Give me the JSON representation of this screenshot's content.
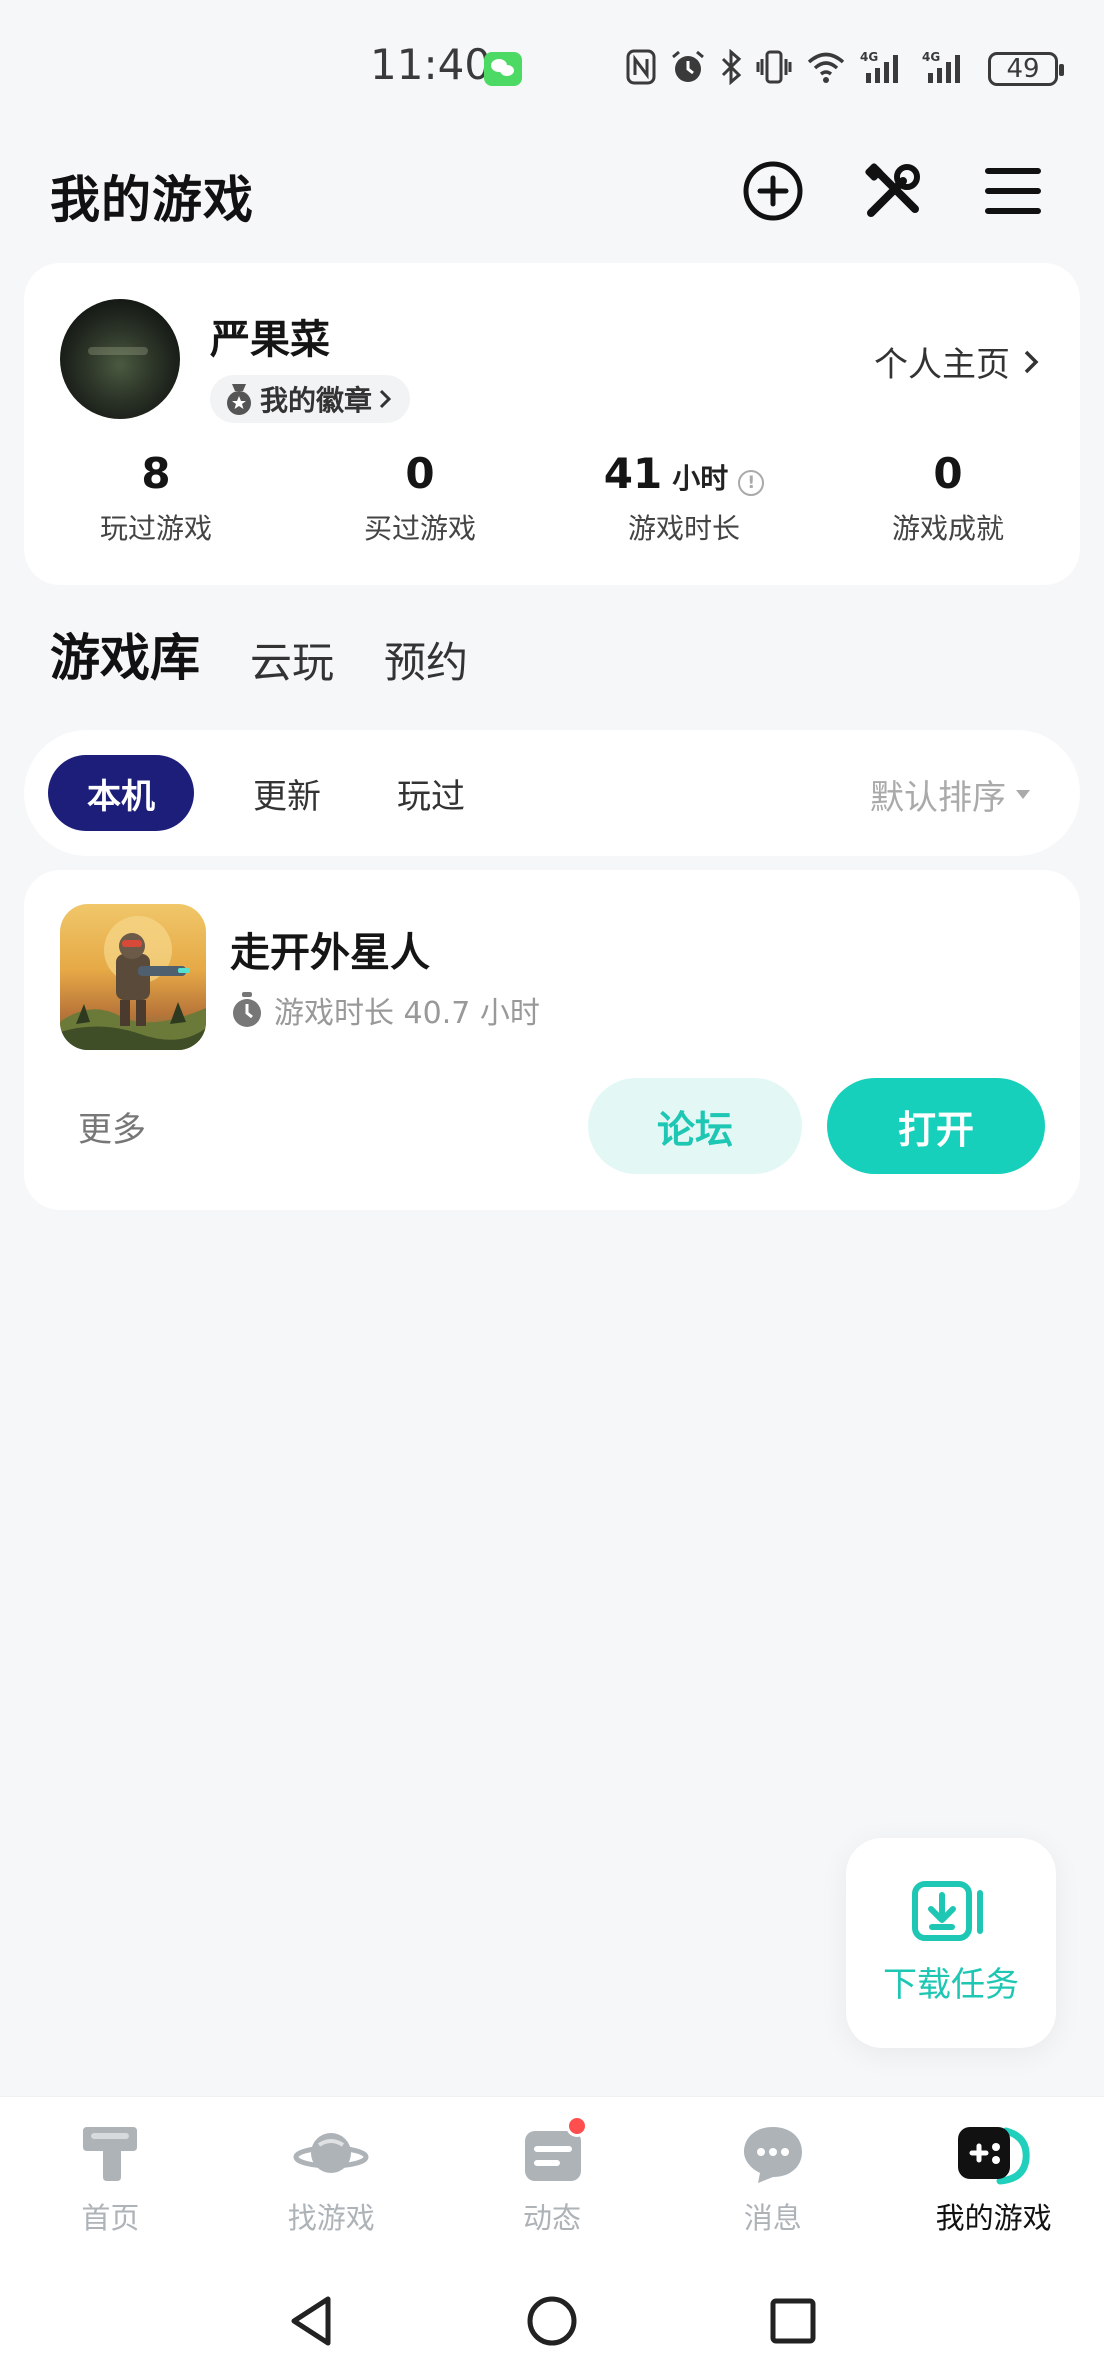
{
  "status_bar": {
    "time": "11:40",
    "battery": "49",
    "icons": [
      "nfc-icon",
      "alarm-icon",
      "bluetooth-icon",
      "vibrate-icon",
      "wifi-icon",
      "signal-4g-icon",
      "signal-4g-icon",
      "battery-icon"
    ]
  },
  "header": {
    "title": "我的游戏",
    "actions": [
      "add-icon",
      "tools-icon",
      "menu-icon"
    ]
  },
  "profile": {
    "name": "严果菜",
    "badge_label": "我的徽章",
    "home_link": "个人主页",
    "stats": [
      {
        "value": "8",
        "unit": "",
        "label": "玩过游戏"
      },
      {
        "value": "0",
        "unit": "",
        "label": "买过游戏"
      },
      {
        "value": "41",
        "unit": "小时",
        "label": "游戏时长"
      },
      {
        "value": "0",
        "unit": "",
        "label": "游戏成就"
      }
    ]
  },
  "tabs": [
    {
      "label": "游戏库",
      "active": true
    },
    {
      "label": "云玩",
      "active": false
    },
    {
      "label": "预约",
      "active": false
    }
  ],
  "filters": {
    "chips": [
      {
        "label": "本机",
        "active": true
      },
      {
        "label": "更新",
        "active": false
      },
      {
        "label": "玩过",
        "active": false
      }
    ],
    "sort_label": "默认排序"
  },
  "game": {
    "name": "走开外星人",
    "playtime": "游戏时长 40.7 小时",
    "more_label": "更多",
    "forum_label": "论坛",
    "open_label": "打开"
  },
  "download_fab": {
    "label": "下载任务"
  },
  "bottom_nav": [
    {
      "label": "首页",
      "icon": "home-icon",
      "active": false
    },
    {
      "label": "找游戏",
      "icon": "planet-icon",
      "active": false
    },
    {
      "label": "动态",
      "icon": "feed-icon",
      "active": false,
      "has_dot": true
    },
    {
      "label": "消息",
      "icon": "message-icon",
      "active": false
    },
    {
      "label": "我的游戏",
      "icon": "gamepad-icon",
      "active": true
    }
  ],
  "colors": {
    "accent": "#16d0bb",
    "chip_active": "#1c1e7a",
    "background": "#f5f7f9",
    "notification_dot": "#ff4e4e"
  }
}
